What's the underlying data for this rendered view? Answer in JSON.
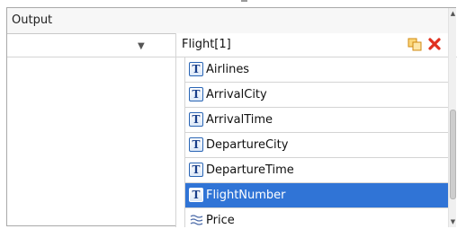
{
  "panel": {
    "header_label": "Output",
    "root": {
      "label": "Flight[1]",
      "expander_icon": "collapse-triangle-icon"
    },
    "items": [
      {
        "label": "Airlines",
        "icon": "T",
        "selected": false
      },
      {
        "label": "ArrivalCity",
        "icon": "T",
        "selected": false
      },
      {
        "label": "ArrivalTime",
        "icon": "T",
        "selected": false
      },
      {
        "label": "DepartureCity",
        "icon": "T",
        "selected": false
      },
      {
        "label": "DepartureTime",
        "icon": "T",
        "selected": false
      },
      {
        "label": "FlightNumber",
        "icon": "T",
        "selected": true
      },
      {
        "label": "Price",
        "icon": "price-icon",
        "selected": false
      }
    ]
  },
  "colors": {
    "selection": "#3074d6",
    "delete": "#e0301e",
    "copy": "#f0a020"
  }
}
